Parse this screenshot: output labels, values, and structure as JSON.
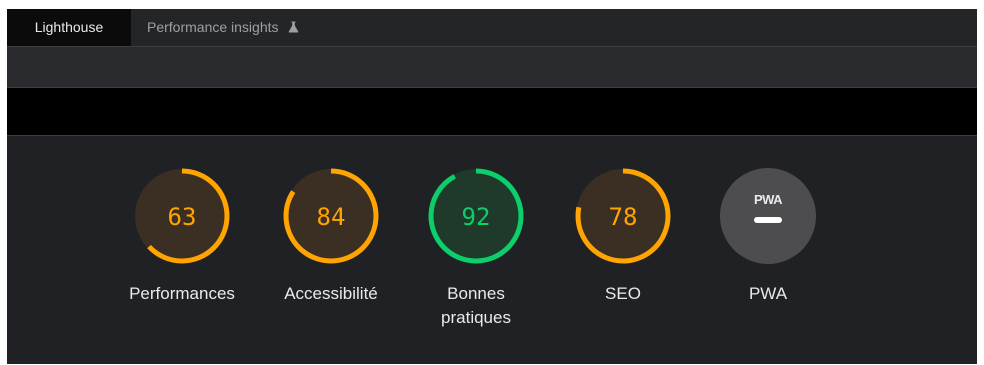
{
  "tabs": [
    {
      "label": "Lighthouse",
      "active": true
    },
    {
      "label": "Performance insights",
      "icon": "flask-icon",
      "active": false
    }
  ],
  "colors": {
    "average": "#ffa400",
    "pass": "#0cce6b",
    "average_bg": "#3a2f22",
    "pass_bg": "#1f3a2a",
    "pwa_bg": "#4d4d4f"
  },
  "categories": [
    {
      "id": "performance",
      "label": "Performances",
      "score": "63",
      "fraction": 0.63,
      "status": "average"
    },
    {
      "id": "accessibility",
      "label": "Accessibilité",
      "score": "84",
      "fraction": 0.84,
      "status": "average"
    },
    {
      "id": "best-practices",
      "label": "Bonnes pratiques",
      "score": "92",
      "fraction": 0.92,
      "status": "pass"
    },
    {
      "id": "seo",
      "label": "SEO",
      "score": "78",
      "fraction": 0.78,
      "status": "average"
    }
  ],
  "pwa": {
    "badge_text": "PWA",
    "label": "PWA",
    "icon": "pwa-badge-icon"
  }
}
